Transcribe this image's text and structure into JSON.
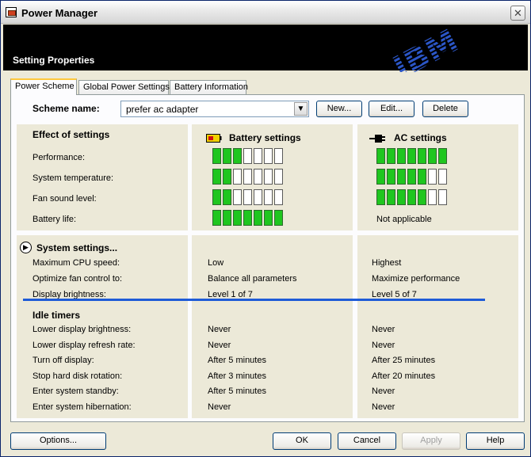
{
  "window": {
    "title": "Power Manager",
    "close_glyph": "✕"
  },
  "banner": {
    "title": "Setting Properties",
    "logo": "IBM"
  },
  "tabs": [
    {
      "label": "Power Scheme",
      "active": true
    },
    {
      "label": "Global Power Settings",
      "active": false
    },
    {
      "label": "Battery Information",
      "active": false
    }
  ],
  "scheme": {
    "label": "Scheme name:",
    "value": "prefer ac adapter",
    "buttons": {
      "new": "New...",
      "edit": "Edit...",
      "delete": "Delete"
    }
  },
  "effects": {
    "header": "Effect of settings",
    "battery_header": "Battery settings",
    "ac_header": "AC settings",
    "rows": [
      {
        "label": "Performance:",
        "battery_level": 3,
        "ac_level": 7
      },
      {
        "label": "System temperature:",
        "battery_level": 2,
        "ac_level": 5
      },
      {
        "label": "Fan sound level:",
        "battery_level": 2,
        "ac_level": 5
      },
      {
        "label": "Battery life:",
        "battery_level": 7,
        "ac_text": "Not applicable"
      }
    ],
    "max_level": 7
  },
  "system": {
    "header": "System settings...",
    "rows": [
      {
        "label": "Maximum CPU speed:",
        "battery": "Low",
        "ac": "Highest"
      },
      {
        "label": "Optimize fan control to:",
        "battery": "Balance all parameters",
        "ac": "Maximize performance"
      },
      {
        "label": "Display brightness:",
        "battery": "Level 1 of 7",
        "ac": "Level 5 of 7"
      }
    ]
  },
  "idle": {
    "header": "Idle timers",
    "rows": [
      {
        "label": "Lower display brightness:",
        "battery": "Never",
        "ac": "Never"
      },
      {
        "label": "Lower display refresh rate:",
        "battery": "Never",
        "ac": "Never"
      },
      {
        "label": "Turn off display:",
        "battery": "After 5 minutes",
        "ac": "After 25 minutes"
      },
      {
        "label": "Stop hard disk rotation:",
        "battery": "After 3 minutes",
        "ac": "After 20 minutes"
      },
      {
        "label": "Enter system standby:",
        "battery": "After 5 minutes",
        "ac": "Never"
      },
      {
        "label": "Enter system hibernation:",
        "battery": "Never",
        "ac": "Never"
      }
    ]
  },
  "footer": {
    "options": "Options...",
    "ok": "OK",
    "cancel": "Cancel",
    "apply": "Apply",
    "help": "Help"
  },
  "colors": {
    "bar_on": "#1fc61f",
    "highlight_line": "#1e5bd7"
  }
}
